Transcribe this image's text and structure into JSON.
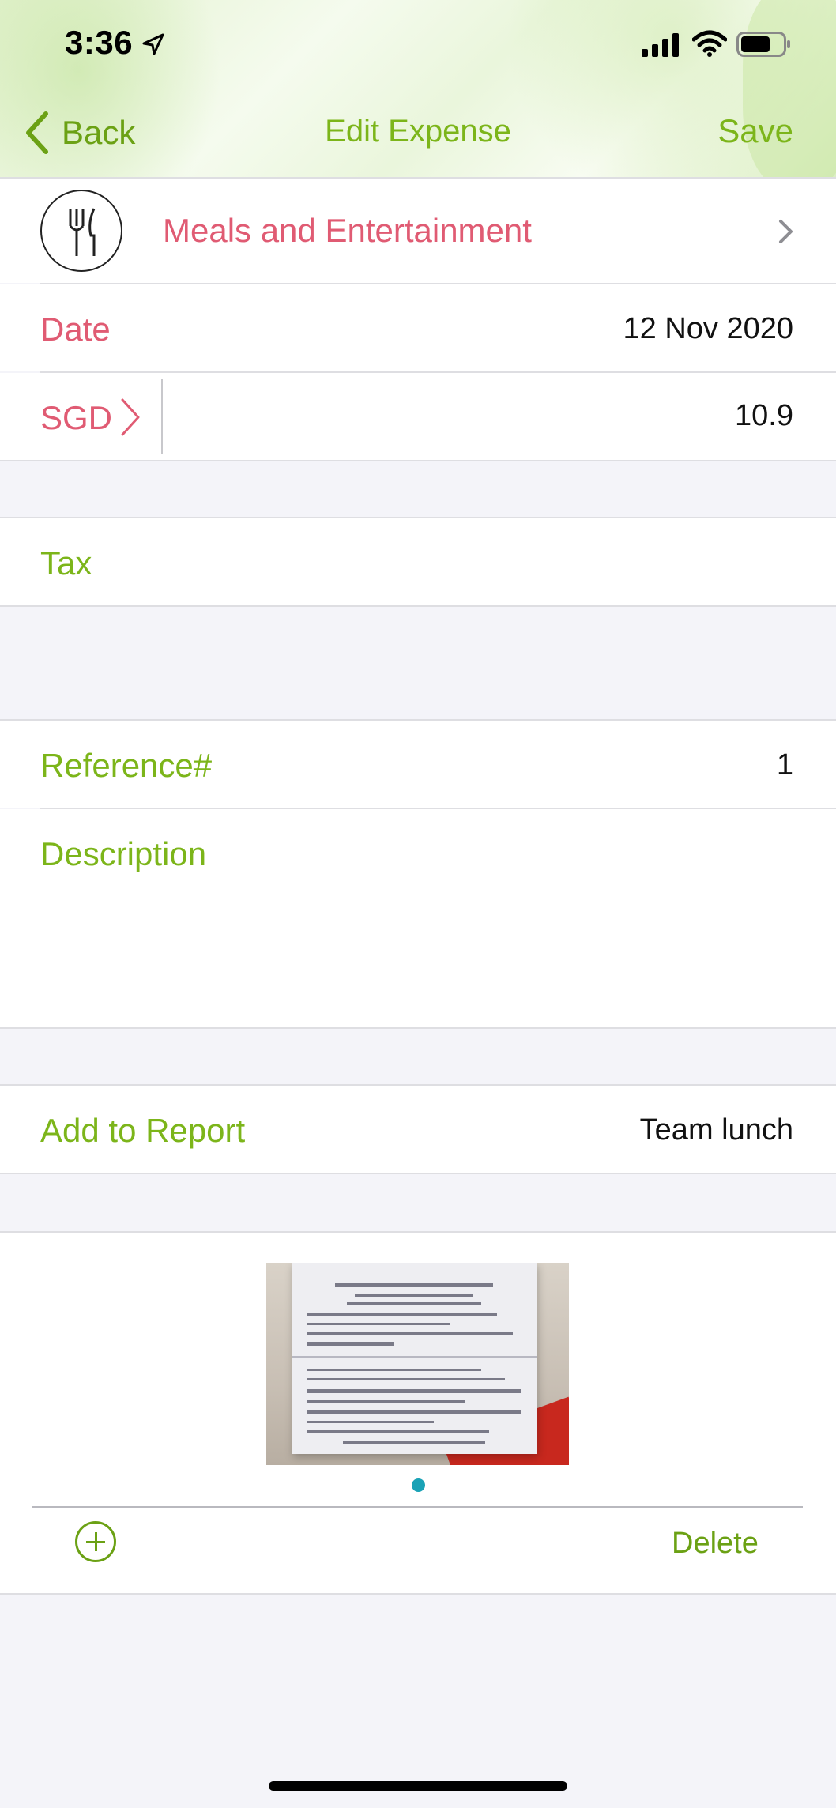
{
  "status_bar": {
    "time": "3:36"
  },
  "nav": {
    "back_label": "Back",
    "title": "Edit Expense",
    "save_label": "Save"
  },
  "category": {
    "label": "Meals and Entertainment",
    "icon": "fork-knife-icon"
  },
  "date": {
    "label": "Date",
    "value": "12 Nov 2020"
  },
  "amount": {
    "currency": "SGD",
    "value": "10.9"
  },
  "tax": {
    "label": "Tax"
  },
  "reference": {
    "label": "Reference#",
    "value": "1"
  },
  "description": {
    "label": "Description",
    "value": ""
  },
  "report": {
    "label": "Add to Report",
    "value": "Team lunch"
  },
  "attachments": {
    "delete_label": "Delete"
  },
  "colors": {
    "accent_green": "#7cb51a",
    "accent_red": "#e05b73",
    "page_dot": "#1aa2b6"
  }
}
